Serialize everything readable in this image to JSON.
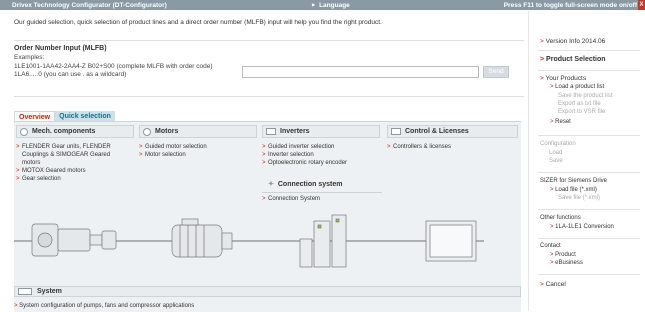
{
  "topbar": {
    "title": "Drivex Technology Configurator (DT-Configurator)",
    "language": "Language",
    "hint": "Press F11 to toggle full-screen mode on/off",
    "close_glyph": "X"
  },
  "intro": "Our guided selection, quick selection of product lines and a direct order number (MLFB) input will help you find the right product.",
  "order": {
    "title": "Order Number Input (MLFB)",
    "examples_label": "Examples:",
    "example1": "1LE1001-1AA42-2AA4-Z B02+S00 (complete MLFB with order code)",
    "example2": "1LA6.....0 (you can use . as a wildcard)",
    "input_value": "",
    "send_label": "Send"
  },
  "tabs": [
    {
      "label": "Overview",
      "active": true
    },
    {
      "label": "Quick selection",
      "active": false
    }
  ],
  "columns": [
    {
      "title": "Mech. components",
      "links": [
        "FLENDER Gear units, FLENDER Couplings & SIMOGEAR Geared motors",
        "MOTOX Geared motors",
        "Gear selection"
      ]
    },
    {
      "title": "Motors",
      "links": [
        "Guided motor selection",
        "Motor selection"
      ]
    },
    {
      "title": "Inverters",
      "links": [
        "Guided inverter selection",
        "Inverter selection",
        "Optoelectronic rotary encoder"
      ]
    },
    {
      "title": "Control & Licenses",
      "links": [
        "Controllers & licenses"
      ]
    }
  ],
  "connection": {
    "title": "Connection system",
    "link": "Connection System"
  },
  "system": {
    "title": "System",
    "link": "System configuration of pumps, fans and compressor applications"
  },
  "sidebar": {
    "version": "Version Info 2014.06",
    "product_selection": "Product Selection",
    "your_products": "Your Products",
    "load_list": "Load a product list",
    "save_list": "Save the product list",
    "export_txt": "Export as txt file",
    "export_vsr": "Export to VSR file",
    "reset": "Reset",
    "configuration": "Configuration",
    "load": "Load",
    "save": "Save",
    "sizer": "SIZER for Siemens Drive",
    "load_file": "Load file (*.xml)",
    "save_file": "Save file (*.xml)",
    "other_functions": "Other functions",
    "conversion": "1LA-1LE1 Conversion",
    "contact": "Contact",
    "product": "Product",
    "ebusiness": "eBusiness",
    "cancel": "Cancel"
  },
  "colors": {
    "topbar": "#8a9aa5",
    "accent_red": "#cc2200",
    "tab_blue": "#1a6d8c",
    "panel_bg": "#eef1f3"
  }
}
